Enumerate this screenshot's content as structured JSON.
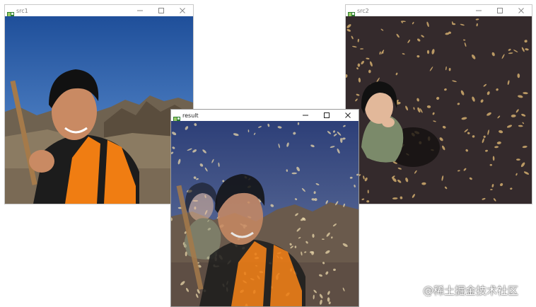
{
  "windows": {
    "src1": {
      "title": "src1",
      "image_alt": "man in orange vest smiling in front of mountains"
    },
    "src2": {
      "title": "src2",
      "image_alt": "woman crouching on leaf-covered ground at night"
    },
    "result": {
      "title": "result",
      "image_alt": "blended image of src1 and src2"
    }
  },
  "window_controls": {
    "minimize_icon": "minimize-icon",
    "maximize_icon": "maximize-icon",
    "close_icon": "close-icon"
  },
  "watermark": {
    "text": "@稀土掘金技术社区",
    "url": "https://blog.csdn.net/..."
  },
  "colors": {
    "sky": "#2f5da8",
    "vest": "#f07d12",
    "ground_dark": "#3a2e2a",
    "leaf": "#c9a56a"
  }
}
